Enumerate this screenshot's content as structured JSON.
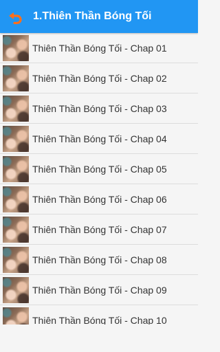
{
  "app_bar": {
    "title": "1.Thiên Thần Bóng Tối",
    "back_icon": "undo-arrow-icon",
    "background_color": "#2196f3",
    "back_icon_color": "#ff6f1a"
  },
  "chapters": [
    {
      "label": "Thiên Thần Bóng Tối - Chap 01"
    },
    {
      "label": "Thiên Thần Bóng Tối - Chap 02"
    },
    {
      "label": "Thiên Thần Bóng Tối - Chap 03"
    },
    {
      "label": "Thiên Thần Bóng Tối - Chap 04"
    },
    {
      "label": "Thiên Thần Bóng Tối - Chap 05"
    },
    {
      "label": "Thiên Thần Bóng Tối - Chap 06"
    },
    {
      "label": "Thiên Thần Bóng Tối - Chap 07"
    },
    {
      "label": "Thiên Thần Bóng Tối - Chap 08"
    },
    {
      "label": "Thiên Thần Bóng Tối - Chap 09"
    },
    {
      "label": "Thiên Thần Bóng Tối - Chap 10"
    }
  ]
}
